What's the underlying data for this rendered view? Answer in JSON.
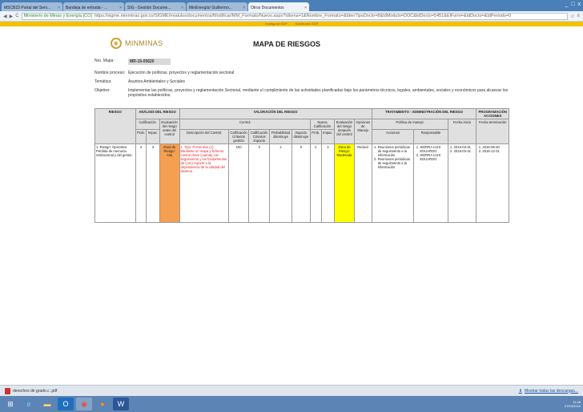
{
  "browser": {
    "tabs": [
      {
        "label": "MSCB23 Portal del Serv..."
      },
      {
        "label": "Bandeja de entrada - ..."
      },
      {
        "label": "SIG - Gestión Docume..."
      },
      {
        "label": "MinEnergía/ Guillermo..."
      },
      {
        "label": "Otros Documentos"
      }
    ],
    "site_name": "Ministerio de Minas y Energía [CO]",
    "url": "https://sigme.minminas.gov.co/SIGME/modulos/documentos/Modificar/MM_Formato/Nuevo.aspx?Idioma=1&Nombre_Formato=&IdenTipoDocto=8&IdModulo=DOC&IdDocto=5451&ElForm=&IdDocto=&IdPeriodo=0",
    "bookmarks": [
      "Configurar SDP",
      "Solicitudes SDP"
    ],
    "window_controls": [
      "_",
      "□",
      "x"
    ]
  },
  "header": {
    "logo_text": "MINMINAS",
    "title": "MAPA DE RIESGOS"
  },
  "meta": {
    "nro_label": "Nro. Mapa:",
    "nro_value": "MR-15-05620",
    "proceso_label": "Nombre proceso:",
    "proceso_value": "Ejecución de políticas, proyectos y reglamentación sectorial",
    "tematica_label": "Temática:",
    "tematica_value": "Asuntos Ambientales y Sociales",
    "objetivo_label": "Objetivo:",
    "objetivo_value": "Implementar las políticas, proyectos y reglamentación Sectorial, mediante el cumplimiento de las actividades planificadas bajo los parámetros técnicos, legales, ambientales, sociales y económicos para alcanzar los propósitos establecidos."
  },
  "table": {
    "groups": {
      "riesgo": "RIESGO",
      "analisis": "ANÁLISIS DEL RIESGO",
      "valoracion": "VALORACIÓN DEL RIESGO",
      "tratamiento": "TRATAMIENTO - ADMINISTRACIÓN DEL RIESGO",
      "programacion": "PROGRAMACIÓN ACCIONES"
    },
    "sub": {
      "calificacion": "Calificación",
      "evaluacion": "Evaluación del riesgo antes del control",
      "controles": "Control",
      "nueva_calificacion": "Nueva Calificación",
      "evaluacion_despues": "Evaluación del riesgo después del control",
      "opciones": "Opciones de Manejo",
      "politica": "Política de manejo",
      "fecha_inicio": "Fecha inicio",
      "fecha_terminacion": "Fecha terminación"
    },
    "cols": {
      "prob": "Prob.",
      "impact": "Impac.",
      "descripcion": "Descripción del Control",
      "calif_criterio": "Calificación Criterios gestión",
      "calif_criterio_ef": "Calificación Criterios impacto",
      "probabilidad": "Probabilidad disminuye",
      "impacto": "Impacto disminuye",
      "prob2": "Prob.",
      "impact2": "Impac.",
      "acciones": "Acciones",
      "responsable": "Responsable"
    },
    "row": {
      "riesgo": "1. Riesgo: Operativo. Pérdida de memoria institucional y del gestor.",
      "prob": "4",
      "impact": "3",
      "evaluacion": "Zona de Riesgo: Alta",
      "control": "1. Tipo: Preventivo (1): Mediante un mapa y ficheros control clave (cuenta) con seguimiento y los fundamentos de (con) reporte a la dependencia de la calidad del sistema",
      "calif1": "100",
      "calif2": "0",
      "prob_dism": "2",
      "imp_dism": "0",
      "prob2": "2",
      "impact2": "3",
      "evaluacion2": "Zona de Riesgo: Moderada",
      "opcion": "Reducir",
      "acciones": [
        "Reuniones periódicas de seguimiento a la información",
        "Reuniones periódicas de seguimiento a la información"
      ],
      "responsables": [
        "SIERRA LUIS EDUARDO",
        "SIERRA LUIS EDUARDO"
      ],
      "fechas_inicio": [
        "2016-03-31",
        "2016-03-31"
      ],
      "fechas_fin": [
        "2016-06-30",
        "2016-12-31"
      ]
    }
  },
  "downloads": {
    "item": "derechos de grado.c .pdf",
    "show_all": "Mostrar todas las descargas..."
  },
  "tray": {
    "time": "11:08",
    "date": "07/04/2016"
  },
  "colors": {
    "orange_zone": "#f4a050",
    "yellow_zone": "#ffff00",
    "red_text": "#e0262c"
  }
}
